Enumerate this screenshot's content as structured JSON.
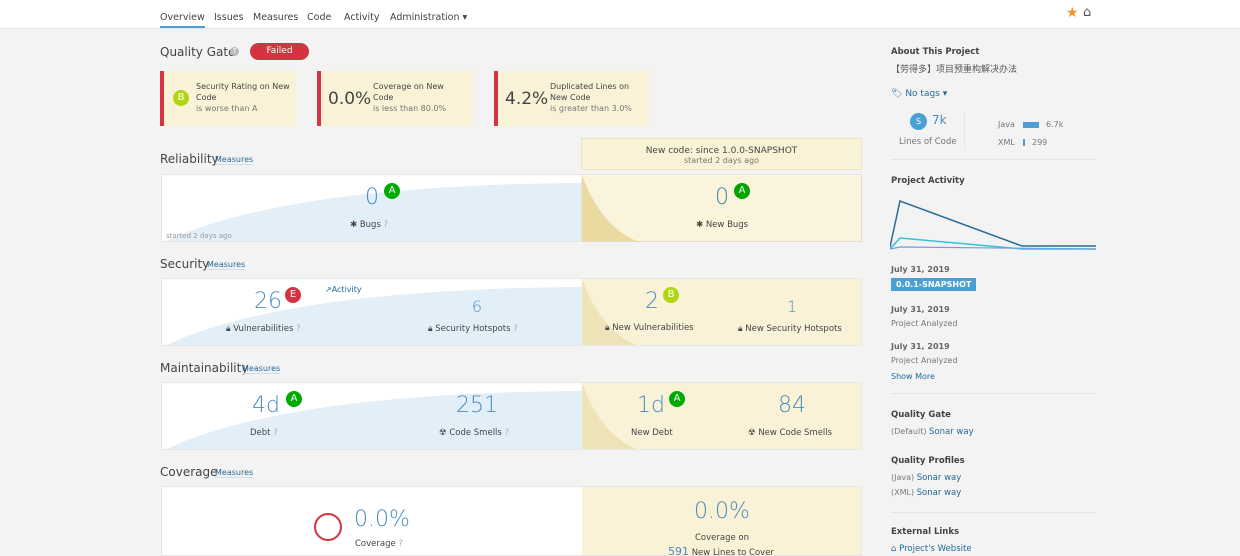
{
  "nav": {
    "items": [
      "Overview",
      "Issues",
      "Measures",
      "Code",
      "Activity",
      "Administration"
    ],
    "active": "Overview"
  },
  "quality_gate": {
    "title": "Quality Gate",
    "status": "Failed",
    "conditions": [
      {
        "rating": "B",
        "title": "Security Rating on New Code",
        "line1": "Security Rating on New",
        "line2": "Code",
        "detail": "is worse than A"
      },
      {
        "value": "0.0%",
        "line1": "Coverage on New",
        "line2": "Code",
        "detail": "is less than 80.0%"
      },
      {
        "value": "4.2%",
        "line1": "Duplicated Lines on",
        "line2": "New Code",
        "detail": "is greater than 3.0%"
      }
    ]
  },
  "new_code": {
    "title": "New code: since 1.0.0-SNAPSHOT",
    "sub": "started 2 days ago"
  },
  "measures_link": "Measures",
  "reliability": {
    "title": "Reliability",
    "bugs": "0",
    "bugs_rating": "A",
    "bugs_label": "Bugs",
    "started": "started 2 days ago",
    "new_bugs": "0",
    "new_bugs_rating": "A",
    "new_bugs_label": "New Bugs"
  },
  "security": {
    "title": "Security",
    "vulns": "26",
    "vulns_rating": "E",
    "vulns_label": "Vulnerabilities",
    "activity": "Activity",
    "hotspots": "6",
    "hotspots_label": "Security Hotspots",
    "new_vulns": "2",
    "new_vulns_rating": "B",
    "new_vulns_label": "New Vulnerabilities",
    "new_hotspots": "1",
    "new_hotspots_label": "New Security Hotspots"
  },
  "maintainability": {
    "title": "Maintainability",
    "debt": "4d",
    "debt_rating": "A",
    "debt_label": "Debt",
    "smells": "251",
    "smells_label": "Code Smells",
    "new_debt": "1d",
    "new_debt_rating": "A",
    "new_debt_label": "New Debt",
    "new_smells": "84",
    "new_smells_label": "New Code Smells"
  },
  "coverage": {
    "title": "Coverage",
    "value": "0.0%",
    "label": "Coverage",
    "new_value": "0.0%",
    "new_label": "Coverage on",
    "new_lines": "591",
    "new_lines_label": "New Lines to Cover"
  },
  "sidebar": {
    "about_title": "About This Project",
    "project_name": "【劳得多】项目预重构解决办法",
    "tags": "No tags",
    "size": "S",
    "loc": "7k",
    "loc_label": "Lines of Code",
    "languages": [
      {
        "name": "Java",
        "value": "6.7k",
        "fraction": 1
      },
      {
        "name": "XML",
        "value": "299",
        "fraction": 0.045
      }
    ],
    "activity_title": "Project Activity",
    "events": [
      {
        "date": "July 31, 2019",
        "version": "0.0.1-SNAPSHOT"
      },
      {
        "date": "July 31, 2019",
        "text": "Project Analyzed"
      },
      {
        "date": "July 31, 2019",
        "text": "Project Analyzed"
      }
    ],
    "show_more": "Show More",
    "qg_title": "Quality Gate",
    "qg_default": "(Default)",
    "qg_name": "Sonar way",
    "profiles_title": "Quality Profiles",
    "profiles": [
      {
        "lang": "(Java)",
        "name": "Sonar way"
      },
      {
        "lang": "(XML)",
        "name": "Sonar way"
      }
    ],
    "links_title": "External Links",
    "website": "Project's Website"
  },
  "colors": {
    "failed": "#d4333f",
    "rating_a": "#00aa00",
    "rating_b": "#b0d513",
    "rating_e": "#d4333f",
    "link": "#236a97",
    "new_code_bg": "#f9f2d7"
  }
}
